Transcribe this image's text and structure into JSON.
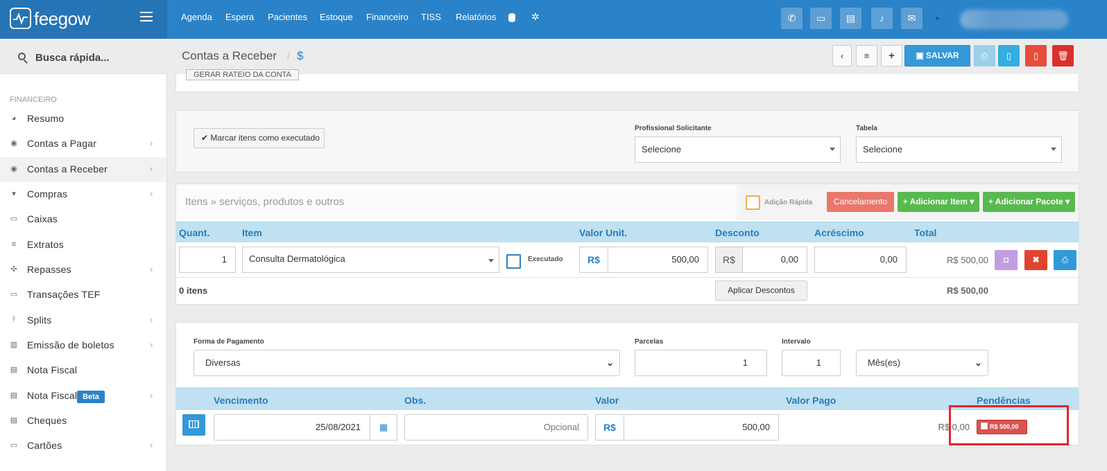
{
  "app": {
    "name": "feegow"
  },
  "nav": {
    "items": [
      "Agenda",
      "Espera",
      "Pacientes",
      "Estoque",
      "Financeiro",
      "TISS",
      "Relatórios"
    ],
    "icons": [
      "database-icon",
      "gear-icon"
    ]
  },
  "topbar_buttons": [
    "phone-icon",
    "inbox-icon",
    "card-icon",
    "bell-icon",
    "chat-icon"
  ],
  "search": {
    "placeholder": "Busca rápida..."
  },
  "sidebar": {
    "section": "FINANCEIRO",
    "items": [
      {
        "label": "Resumo",
        "icon": "pie-chart-icon",
        "chevron": false
      },
      {
        "label": "Contas a Pagar",
        "icon": "arrow-up-circle-icon",
        "chevron": true
      },
      {
        "label": "Contas a Receber",
        "icon": "arrow-down-circle-icon",
        "chevron": true,
        "active": true
      },
      {
        "label": "Compras",
        "icon": "cart-icon",
        "chevron": true
      },
      {
        "label": "Caixas",
        "icon": "inbox-icon",
        "chevron": false
      },
      {
        "label": "Extratos",
        "icon": "list-icon",
        "chevron": false
      },
      {
        "label": "Repasses",
        "icon": "puzzle-icon",
        "chevron": true
      },
      {
        "label": "Transações TEF",
        "icon": "credit-card-icon",
        "chevron": false
      },
      {
        "label": "Splits",
        "icon": "split-icon",
        "chevron": true
      },
      {
        "label": "Emissão de boletos",
        "icon": "barcode-icon",
        "chevron": true
      },
      {
        "label": "Nota Fiscal",
        "icon": "file-icon",
        "chevron": false
      },
      {
        "label": "Nota Fiscal",
        "icon": "file-icon",
        "chevron": true,
        "badge": "Beta"
      },
      {
        "label": "Cheques",
        "icon": "cheque-icon",
        "chevron": false
      },
      {
        "label": "Cartões",
        "icon": "credit-card-icon",
        "chevron": true
      }
    ]
  },
  "page": {
    "title": "Contas a Receber",
    "separator": "/",
    "title_icon": "$",
    "save_label": "SALVAR",
    "rateio_label": "GERAR RATEIO DA CONTA"
  },
  "exec_panel": {
    "marcar_label": "Marcar itens como executado",
    "profissional_label": "Profissional Solicitante",
    "profissional_value": "Selecione",
    "tabela_label": "Tabela",
    "tabela_value": "Selecione"
  },
  "items": {
    "title": "Itens » serviços, produtos e outros",
    "adicao_label": "Adição Rápida",
    "cancel_label": "Cancelamento",
    "add_item_label": "+ Adicionar Item ▾",
    "add_pacote_label": "+ Adicionar Pacote ▾",
    "columns": [
      "Quant.",
      "Item",
      "Valor Unit.",
      "Desconto",
      "Acréscimo",
      "Total"
    ],
    "row": {
      "quant": "1",
      "item": "Consulta Dermatológica",
      "executado_label": "Executado",
      "currency": "R$",
      "valor_unit": "500,00",
      "desconto": "0,00",
      "acrescimo": "0,00",
      "total": "R$ 500,00"
    },
    "count": "0 itens",
    "aplicar_label": "Aplicar Descontos",
    "grand_total": "R$ 500,00"
  },
  "payment": {
    "forma_label": "Forma de Pagamento",
    "forma_value": "Diversas",
    "parcelas_label": "Parcelas",
    "parcelas_value": "1",
    "intervalo_label": "Intervalo",
    "intervalo_value": "1",
    "periodo_value": "Mês(es)",
    "columns": [
      "Vencimento",
      "Obs.",
      "Valor",
      "Valor Pago",
      "Pendências"
    ],
    "row": {
      "vencimento": "25/08/2021",
      "obs_placeholder": "Opcional",
      "currency": "R$",
      "valor": "500,00",
      "valor_pago": "R$ 0,00",
      "pendencia": "R$ 500,00"
    }
  },
  "colors": {
    "brand": "#2a83c8",
    "success": "#58b94f",
    "danger": "#d9534f",
    "highlight": "#e3262d"
  }
}
